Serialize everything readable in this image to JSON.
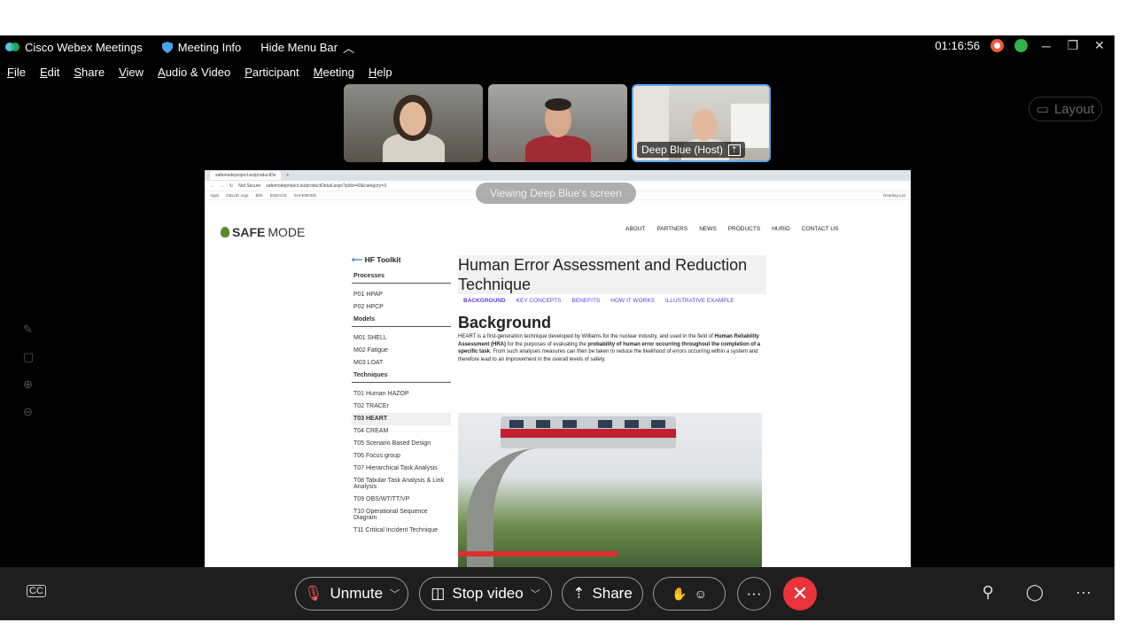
{
  "titlebar": {
    "app": "Cisco Webex Meetings",
    "meeting_info": "Meeting Info",
    "hide_menu": "Hide Menu Bar",
    "clock": "01:16:56"
  },
  "menu": [
    "File",
    "Edit",
    "Share",
    "View",
    "Audio & Video",
    "Participant",
    "Meeting",
    "Help"
  ],
  "videos": {
    "host_label": "Deep Blue (Host)"
  },
  "layout_button": "Layout",
  "shared_screen": {
    "viewing_label": "Viewing Deep Blue's screen",
    "browser": {
      "tab_title": "safemodeproject.eu/productDe",
      "not_secure": "Not Secure",
      "url": "safemodeproject.eu/productDetail.aspx?pIds=43&category=3",
      "bookmarks": [
        "Apps",
        "DBLUE orga",
        "Bills",
        "ENDAGE",
        "SAFEMODE"
      ],
      "reading_list": "Reading List"
    },
    "site": {
      "logo_bold": "SAFE",
      "logo_rest": "MODE",
      "nav": [
        "ABOUT",
        "PARTNERS",
        "NEWS",
        "PRODUCTS",
        "HURID",
        "CONTACT US"
      ],
      "toolkit_title": "HF Toolkit",
      "left_nav": [
        {
          "type": "section",
          "label": "Processes"
        },
        {
          "type": "item",
          "label": "P01 HPAP"
        },
        {
          "type": "item",
          "label": "P02 HPCP"
        },
        {
          "type": "section",
          "label": "Models"
        },
        {
          "type": "item",
          "label": "M01 SHELL"
        },
        {
          "type": "item",
          "label": "M02 Fatigue"
        },
        {
          "type": "item",
          "label": "M03 LOAT"
        },
        {
          "type": "section",
          "label": "Techniques"
        },
        {
          "type": "item",
          "label": "T01 Human HAZOP"
        },
        {
          "type": "item",
          "label": "T02 TRACEr"
        },
        {
          "type": "active",
          "label": "T03 HEART"
        },
        {
          "type": "item",
          "label": "T04 CREAM"
        },
        {
          "type": "item",
          "label": "T05 Scenario Based Design"
        },
        {
          "type": "item",
          "label": "T06 Focus group"
        },
        {
          "type": "item",
          "label": "T07 Hierarchical Task Analysis"
        },
        {
          "type": "item",
          "label": "T08 Tabular Task Analysis & Link Analysis"
        },
        {
          "type": "item",
          "label": "T09 OBS/WT/TT/VP"
        },
        {
          "type": "item",
          "label": "T10 Operational Sequence Diagram"
        },
        {
          "type": "item",
          "label": "T11 Critical Incident Technique"
        }
      ],
      "heading": "Human Error Assessment and Reduction Technique",
      "subnav": [
        "BACKGROUND",
        "KEY CONCEPTS",
        "BENEFITS",
        "HOW IT WORKS",
        "ILLUSTRATIVE EXAMPLE"
      ],
      "section_title": "Background",
      "para_1": "HEART is a first-generation technique developed by Williams for the nuclear industry, and used in the field of",
      "para_bold_1": "Human Reliability Assessment (HRA)",
      "para_2": " for the purposes of evaluating the ",
      "para_bold_2": "probability of human error occurring throughout the completion of a specific task",
      "para_3": ". From such analyses measures can then be taken to reduce the likelihood of errors occurring within a system and therefore lead to an improvement in the overall levels of safety."
    }
  },
  "controls": {
    "unmute": "Unmute",
    "stop_video": "Stop video",
    "share": "Share",
    "cc": "CC"
  }
}
